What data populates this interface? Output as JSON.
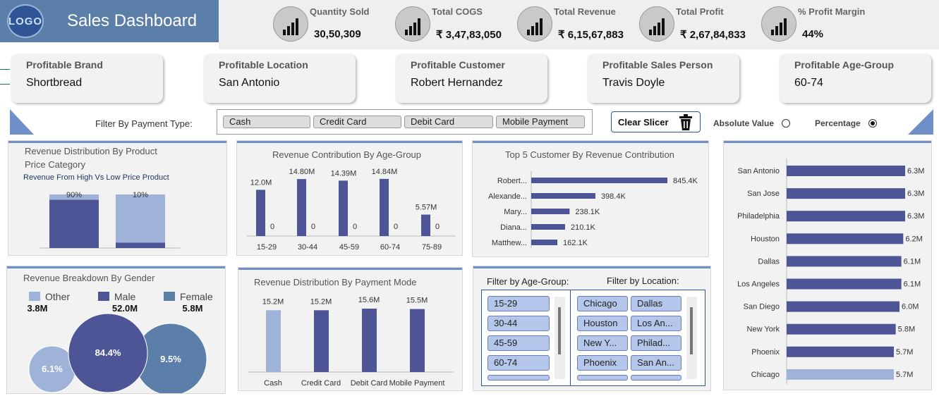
{
  "header": {
    "logo_text": "LOGO",
    "title": "Sales Dashboard"
  },
  "kpis": [
    {
      "label": "Quantity Sold",
      "value": "30,50,309",
      "icon": "bar-chart-up-icon"
    },
    {
      "label": "Total COGS",
      "value": "₹ 3,47,83,050",
      "icon": "line-chart-up-icon"
    },
    {
      "label": "Total Revenue",
      "value": "₹ 6,15,67,883",
      "icon": "revenue-chart-icon"
    },
    {
      "label": "Total Profit",
      "value": "₹ 2,67,84,833",
      "icon": "profit-chart-icon"
    },
    {
      "label": "% Profit Margin",
      "value": "44%",
      "icon": "percent-chart-icon"
    }
  ],
  "cards": [
    {
      "label": "Profitable Brand",
      "value": "Shortbread"
    },
    {
      "label": "Profitable Location",
      "value": "San Antonio"
    },
    {
      "label": "Profitable Customer",
      "value": "Robert Hernandez"
    },
    {
      "label": "Profitable Sales Person",
      "value": "Travis Doyle"
    },
    {
      "label": "Profitable Age-Group",
      "value": "60-74"
    }
  ],
  "filter_bar": {
    "label": "Filter By Payment Type:",
    "options": [
      "Cash",
      "Credit Card",
      "Debit Card",
      "Mobile Payment"
    ],
    "clear_label": "Clear Slicer",
    "absolute_label": "Absolute Value",
    "percentage_label": "Percentage",
    "selected_mode": "Percentage"
  },
  "slicers": {
    "age_title": "Filter by Age-Group:",
    "age_items": [
      "15-29",
      "30-44",
      "45-59",
      "60-74"
    ],
    "location_title": "Filter by Location:",
    "location_items": [
      [
        "Chicago",
        "Dallas"
      ],
      [
        "Houston",
        "Los An..."
      ],
      [
        "New Y...",
        "Philad..."
      ],
      [
        "Phoenix",
        "San An..."
      ]
    ]
  },
  "colors": {
    "accent": "#4e5597",
    "light": "#9fb3d9",
    "steel": "#5b7fa8",
    "panel": "#f2f2f2"
  },
  "chart_data": [
    {
      "id": "price",
      "type": "bar",
      "title": "Revenue Distribution By Product",
      "subtitle": "Price Category",
      "note": "Revenue From High Vs Low Price Product",
      "values": [
        90,
        10
      ],
      "labels": [
        "90%",
        "10%"
      ]
    },
    {
      "id": "age",
      "type": "bar",
      "title": "Revenue Contribution By Age-Group",
      "categories": [
        "15-29",
        "30-44",
        "45-59",
        "60-74",
        "75-89"
      ],
      "series": [
        {
          "values": [
            12.0,
            14.8,
            14.39,
            14.84,
            5.57
          ],
          "labels": [
            "12.0M",
            "14.80M",
            "14.39M",
            "14.84M",
            "5.57M"
          ]
        },
        {
          "values": [
            0,
            0,
            0,
            0,
            0
          ],
          "labels": [
            "0",
            "0",
            "0",
            "0",
            "0"
          ]
        }
      ]
    },
    {
      "id": "top5",
      "type": "bar",
      "title": "Top 5 Customer By Revenue Contribution",
      "categories": [
        "Robert...",
        "Alexande...",
        "Mary...",
        "Diana...",
        "Matthew..."
      ],
      "values": [
        845.4,
        398.4,
        238.1,
        210.1,
        162.1
      ],
      "labels": [
        "845.4K",
        "398.4K",
        "238.1K",
        "210.1K",
        "162.1K"
      ]
    },
    {
      "id": "location",
      "type": "bar",
      "categories": [
        "San Antonio",
        "San Jose",
        "Philadelphia",
        "Houston",
        "Dallas",
        "Los Angeles",
        "San Diego",
        "New York",
        "Phoenix",
        "Chicago"
      ],
      "values": [
        6.3,
        6.3,
        6.3,
        6.2,
        6.1,
        6.1,
        6.0,
        5.8,
        5.7,
        5.7
      ],
      "labels": [
        "6.3M",
        "6.3M",
        "6.3M",
        "6.2M",
        "6.1M",
        "6.1M",
        "6.0M",
        "5.8M",
        "5.7M",
        "5.7M"
      ]
    },
    {
      "id": "gender",
      "type": "pie",
      "title": "Revenue Breakdown By Gender",
      "series": [
        {
          "name": "Other",
          "total": "3.8M",
          "share": 6.1,
          "label": "6.1%"
        },
        {
          "name": "Male",
          "total": "52.0M",
          "share": 84.4,
          "label": "84.4%"
        },
        {
          "name": "Female",
          "total": "5.8M",
          "share": 9.5,
          "label": "9.5%"
        }
      ]
    },
    {
      "id": "payment",
      "type": "bar",
      "title": "Revenue Distribution By Payment Mode",
      "categories": [
        "Cash",
        "Credit Card",
        "Debit Card",
        "Mobile Payment"
      ],
      "values": [
        15.2,
        15.2,
        15.6,
        15.5
      ],
      "labels": [
        "15.2M",
        "15.2M",
        "15.6M",
        "15.5M"
      ]
    }
  ]
}
